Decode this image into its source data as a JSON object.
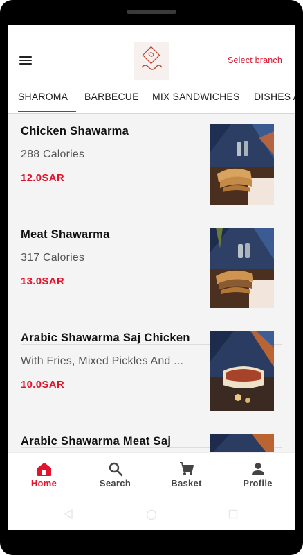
{
  "header": {
    "menu_icon": "hamburger-menu-icon",
    "logo": "restaurant-logo",
    "select_branch": "Select branch"
  },
  "tabs": [
    {
      "label": "SHAROMA",
      "active": true
    },
    {
      "label": "BARBECUE",
      "active": false
    },
    {
      "label": "MIX SANDWICHES",
      "active": false
    },
    {
      "label": "DISHES A",
      "active": false
    }
  ],
  "items": [
    {
      "name": "Chicken Shawarma",
      "desc": "288 Calories",
      "price": "12.0SAR",
      "image": "chicken-shawarma-photo"
    },
    {
      "name": "Meat Shawarma",
      "desc": "317 Calories",
      "price": "13.0SAR",
      "image": "meat-shawarma-photo"
    },
    {
      "name": "Arabic Shawarma Saj Chicken",
      "desc": "With Fries, Mixed Pickles And ...",
      "price": "10.0SAR",
      "image": "saj-chicken-photo"
    },
    {
      "name": "Arabic Shawarma Meat Saj",
      "desc": "",
      "price": "",
      "image": "saj-meat-photo"
    }
  ],
  "nav": {
    "home": "Home",
    "search": "Search",
    "basket": "Basket",
    "profile": "Profile"
  },
  "colors": {
    "accent": "#e2142d",
    "text": "#111111",
    "list_bg": "#f4f4f4"
  }
}
